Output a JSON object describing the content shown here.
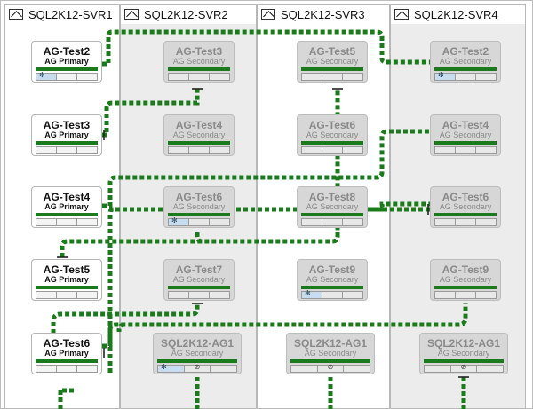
{
  "columns": [
    {
      "title": "SQL2K12-SVR1"
    },
    {
      "title": "SQL2K12-SVR2"
    },
    {
      "title": "SQL2K12-SVR3"
    },
    {
      "title": "SQL2K12-SVR4"
    }
  ],
  "cards": {
    "svr1": [
      {
        "title": "AG-Test2",
        "role": "AG Primary"
      },
      {
        "title": "AG-Test3",
        "role": "AG Primary"
      },
      {
        "title": "AG-Test4",
        "role": "AG Primary"
      },
      {
        "title": "AG-Test5",
        "role": "AG Primary"
      },
      {
        "title": "AG-Test6",
        "role": "AG Primary"
      }
    ],
    "svr2": [
      {
        "title": "AG-Test3",
        "role": "AG Secondary"
      },
      {
        "title": "AG-Test4",
        "role": "AG Secondary"
      },
      {
        "title": "AG-Test6",
        "role": "AG Secondary"
      },
      {
        "title": "AG-Test7",
        "role": "AG Secondary"
      },
      {
        "title": "SQL2K12-AG1",
        "role": "AG Secondary"
      }
    ],
    "svr3": [
      {
        "title": "AG-Test5",
        "role": "AG Secondary"
      },
      {
        "title": "AG-Test6",
        "role": "AG Secondary"
      },
      {
        "title": "AG-Test8",
        "role": "AG Secondary"
      },
      {
        "title": "AG-Test9",
        "role": "AG Secondary"
      },
      {
        "title": "SQL2K12-AG1",
        "role": "AG Secondary"
      }
    ],
    "svr4": [
      {
        "title": "AG-Test2",
        "role": "AG Secondary"
      },
      {
        "title": "AG-Test4",
        "role": "AG Secondary"
      },
      {
        "title": "AG-Test6",
        "role": "AG Secondary"
      },
      {
        "title": "AG-Test9",
        "role": "AG Secondary"
      },
      {
        "title": "SQL2K12-AG1",
        "role": "AG Secondary"
      }
    ]
  },
  "colors": {
    "link_green": "#1b7a1b",
    "card_primary_bg": "#ffffff",
    "card_secondary_bg": "#d7d7d7",
    "lane_shade": "#ececec"
  }
}
